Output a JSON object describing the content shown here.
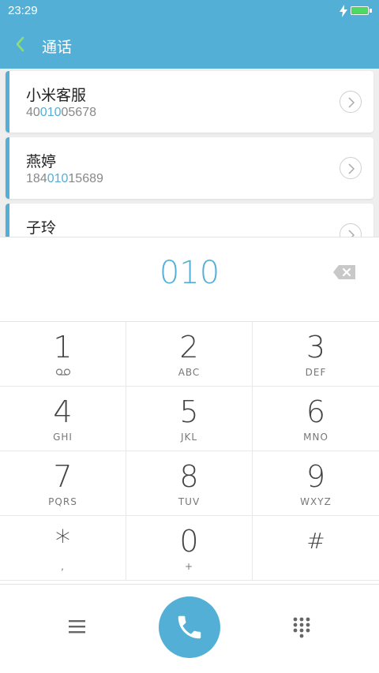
{
  "status": {
    "time": "23:29"
  },
  "header": {
    "title": "通话"
  },
  "contacts": [
    {
      "name": "小米客服",
      "number_pre": "40",
      "number_match": "010",
      "number_post": "05678"
    },
    {
      "name": "燕婷",
      "number_pre": "184",
      "number_match": "010",
      "number_post": "15689"
    },
    {
      "name": "子玲",
      "number_pre": "",
      "number_match": "",
      "number_post": ""
    }
  ],
  "dialer": {
    "input": "010",
    "keys": [
      {
        "digit": "1",
        "letters": ""
      },
      {
        "digit": "2",
        "letters": "ABC"
      },
      {
        "digit": "3",
        "letters": "DEF"
      },
      {
        "digit": "4",
        "letters": "GHI"
      },
      {
        "digit": "5",
        "letters": "JKL"
      },
      {
        "digit": "6",
        "letters": "MNO"
      },
      {
        "digit": "7",
        "letters": "PQRS"
      },
      {
        "digit": "8",
        "letters": "TUV"
      },
      {
        "digit": "9",
        "letters": "WXYZ"
      },
      {
        "digit": "*",
        "letters": ","
      },
      {
        "digit": "0",
        "letters": "+"
      },
      {
        "digit": "#",
        "letters": ""
      }
    ]
  },
  "colors": {
    "accent": "#53afd6",
    "battery": "#4cd964"
  },
  "icons": {
    "back": "chevron-left-icon",
    "delete": "backspace-icon",
    "menu": "menu-icon",
    "call": "phone-icon",
    "keypad": "keypad-icon",
    "voicemail": "voicemail-icon"
  }
}
